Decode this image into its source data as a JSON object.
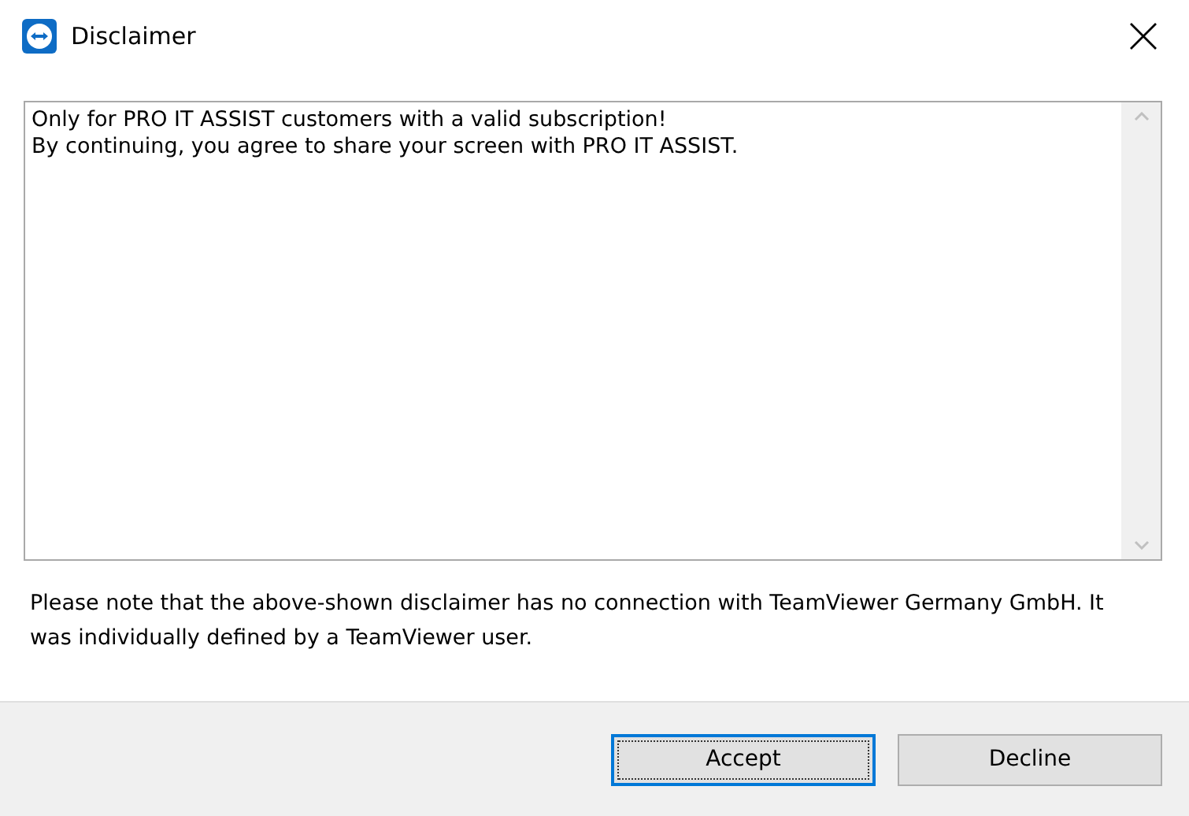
{
  "window": {
    "title": "Disclaimer"
  },
  "disclaimer_text": {
    "lines": [
      "Only for PRO IT ASSIST customers with a valid subscription!",
      "By continuing, you agree to share your screen with PRO IT ASSIST."
    ]
  },
  "note": "Please note that the above-shown disclaimer has no connection with TeamViewer Germany GmbH. It was individually defined by a TeamViewer user.",
  "buttons": [
    {
      "label": "Accept",
      "focused": true
    },
    {
      "label": "Decline",
      "focused": false
    }
  ]
}
